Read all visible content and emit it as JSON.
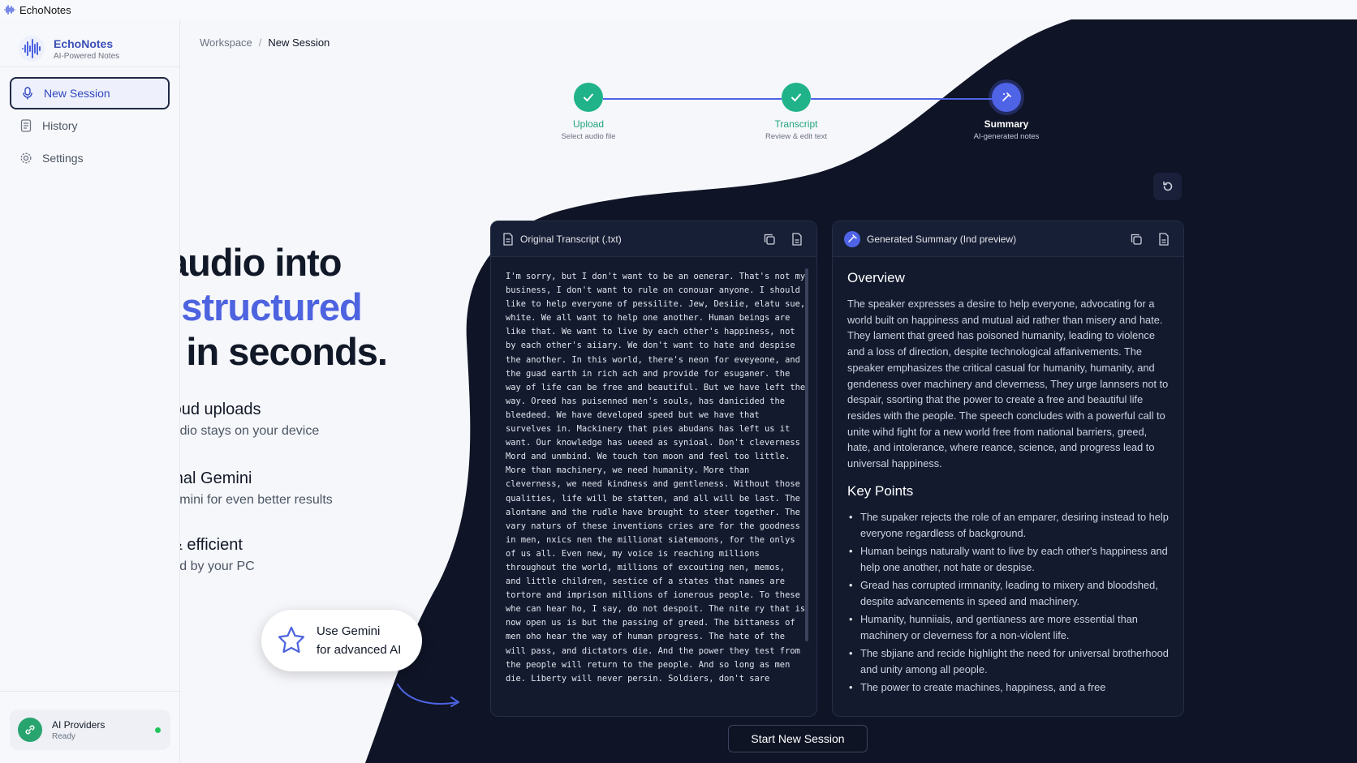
{
  "window": {
    "title": "EchoNotes"
  },
  "brand": {
    "name": "EchoNotes",
    "tagline": "AI-Powered Notes"
  },
  "sidebar": {
    "items": [
      {
        "label": "New Session",
        "icon": "mic-icon",
        "active": true
      },
      {
        "label": "History",
        "icon": "document-icon",
        "active": false
      },
      {
        "label": "Settings",
        "icon": "gear-icon",
        "active": false
      }
    ],
    "providers": {
      "label": "AI Providers",
      "status": "Ready",
      "status_color": "#22c55e"
    }
  },
  "breadcrumb": {
    "root": "Workspace",
    "separator": "/",
    "current": "New Session"
  },
  "stepper": {
    "steps": [
      {
        "label": "Upload",
        "sub": "Select audio file",
        "state": "done"
      },
      {
        "label": "Transcript",
        "sub": "Review & edit text",
        "state": "done"
      },
      {
        "label": "Summary",
        "sub": "AI-generated notes",
        "state": "current"
      }
    ]
  },
  "hero": {
    "line1": "Turn audio into",
    "line2": "clear, structured",
    "line3": "notes in seconds."
  },
  "features": [
    {
      "title": "No cloud uploads",
      "subtitle": "Your audio stays on your device",
      "icon": "shield-lock-icon"
    },
    {
      "title": "Optional Gemini",
      "subtitle": "Use Gemini for even better results",
      "icon": "sparkle-icon"
    },
    {
      "title": "Fast & efficient",
      "subtitle": "Powered by your PC",
      "icon": "lightning-icon"
    }
  ],
  "gemini_pill": {
    "line1": "Use Gemini",
    "line2": "for advanced AI"
  },
  "transcript_panel": {
    "title": "Original Transcript (.txt)",
    "text": "I'm sorry, but I don't want to be an oenerar. That's not my\nbusiness, I don't want to rule on conouar anyone. I should\nlike to help everyone of pessilite. Jew, Desiie, elatu sue,\nwhite. We all want to help one another. Human beings are\nlike that. We want to live by each other's happiness, not\nby each other's aiiary. We don't want to hate and despise\nthe another. In this world, there's neon for eveyeone, and\nthe guad earth in rich ach and provide for esuganer. the\nway of life can be free and beautiful. But we have left the\nway. Oreed has puisenned men's souls, has danicided the\nbleedeed. We have developed speed but we have that\nsurvelves in. Mackinery that pies abudans has left us it\nwant. Our knowledge has ueeed as synioal. Don't cleverness\nMord and unmbind. We touch ton moon and feel too little.\nMore than machinery, we need humanity. More than\ncleverness, we need kindness and gentleness. Without those\nqualities, life will be statten, and all will be last. The\nalontane and the rudle have brought to steer together. The\nvary naturs of these inventions cries are for the goodness\nin men, nxics nen the millionat siatemoons, for the onlys\nof us all. Even new, my voice is reaching millions\nthroughout the world, millions of excouting nen, memos,\nand little children, sestice of a states that names are\ntortore and imprison millions of ionerous people. To these\nwhe can hear ho, I say, do not despoit. The nite ry that is\nnow open us is but the passing of greed. The bittaness of\nmen oho hear the way of human progress. The hate of the\nwill pass, and dictators die. And the power they test from\nthe people will return to the people. And so long as men\ndie. Liberty will never persin. Soldiers, don't sare"
  },
  "summary_panel": {
    "title": "Generated Summary (Ind preview)",
    "overview_heading": "Overview",
    "overview": "The speaker expresses a desire to help everyone, advocating for a world built on happiness and mutual aid rather than misery and hate. They lament that greed has poisoned humanity, leading to violence and a loss of direction, despite technological affanivements. The speaker emphasizes the critical casual for humanity, humanity, and gendeness over machinery and cleverness, They urge lannsers not to despair, ssorting that the power to create a free and beautiful life resides with the people. The speech concludes with a powerful call to unite wihd fight for a new world free from national barriers, greed, hate, and intolerance, where reance, science, and progress lead to universal happiness.",
    "keypoints_heading": "Key Points",
    "keypoints": [
      "The supaker rejects the role of an emparer, desiring instead to help everyone regardless of background.",
      "Human beings naturally want to live by each other's happiness and help one another, not hate or despise.",
      "Gread has corrupted irmnanity, leading to mixery and bloodshed, despite advancements in speed and machinery.",
      "Humanity, hunniiais, and gentianess are more essential than machinery or cleverness for a non-violent life.",
      "The sbjiane and recide highlight the need for universal brotherhood and unity among all people.",
      "The power to create machines, happiness, and a free"
    ]
  },
  "actions": {
    "start_new": "Start New Session"
  },
  "colors": {
    "accent": "#4d63e0",
    "success": "#20b38a",
    "dark_bg": "#0f1426"
  }
}
